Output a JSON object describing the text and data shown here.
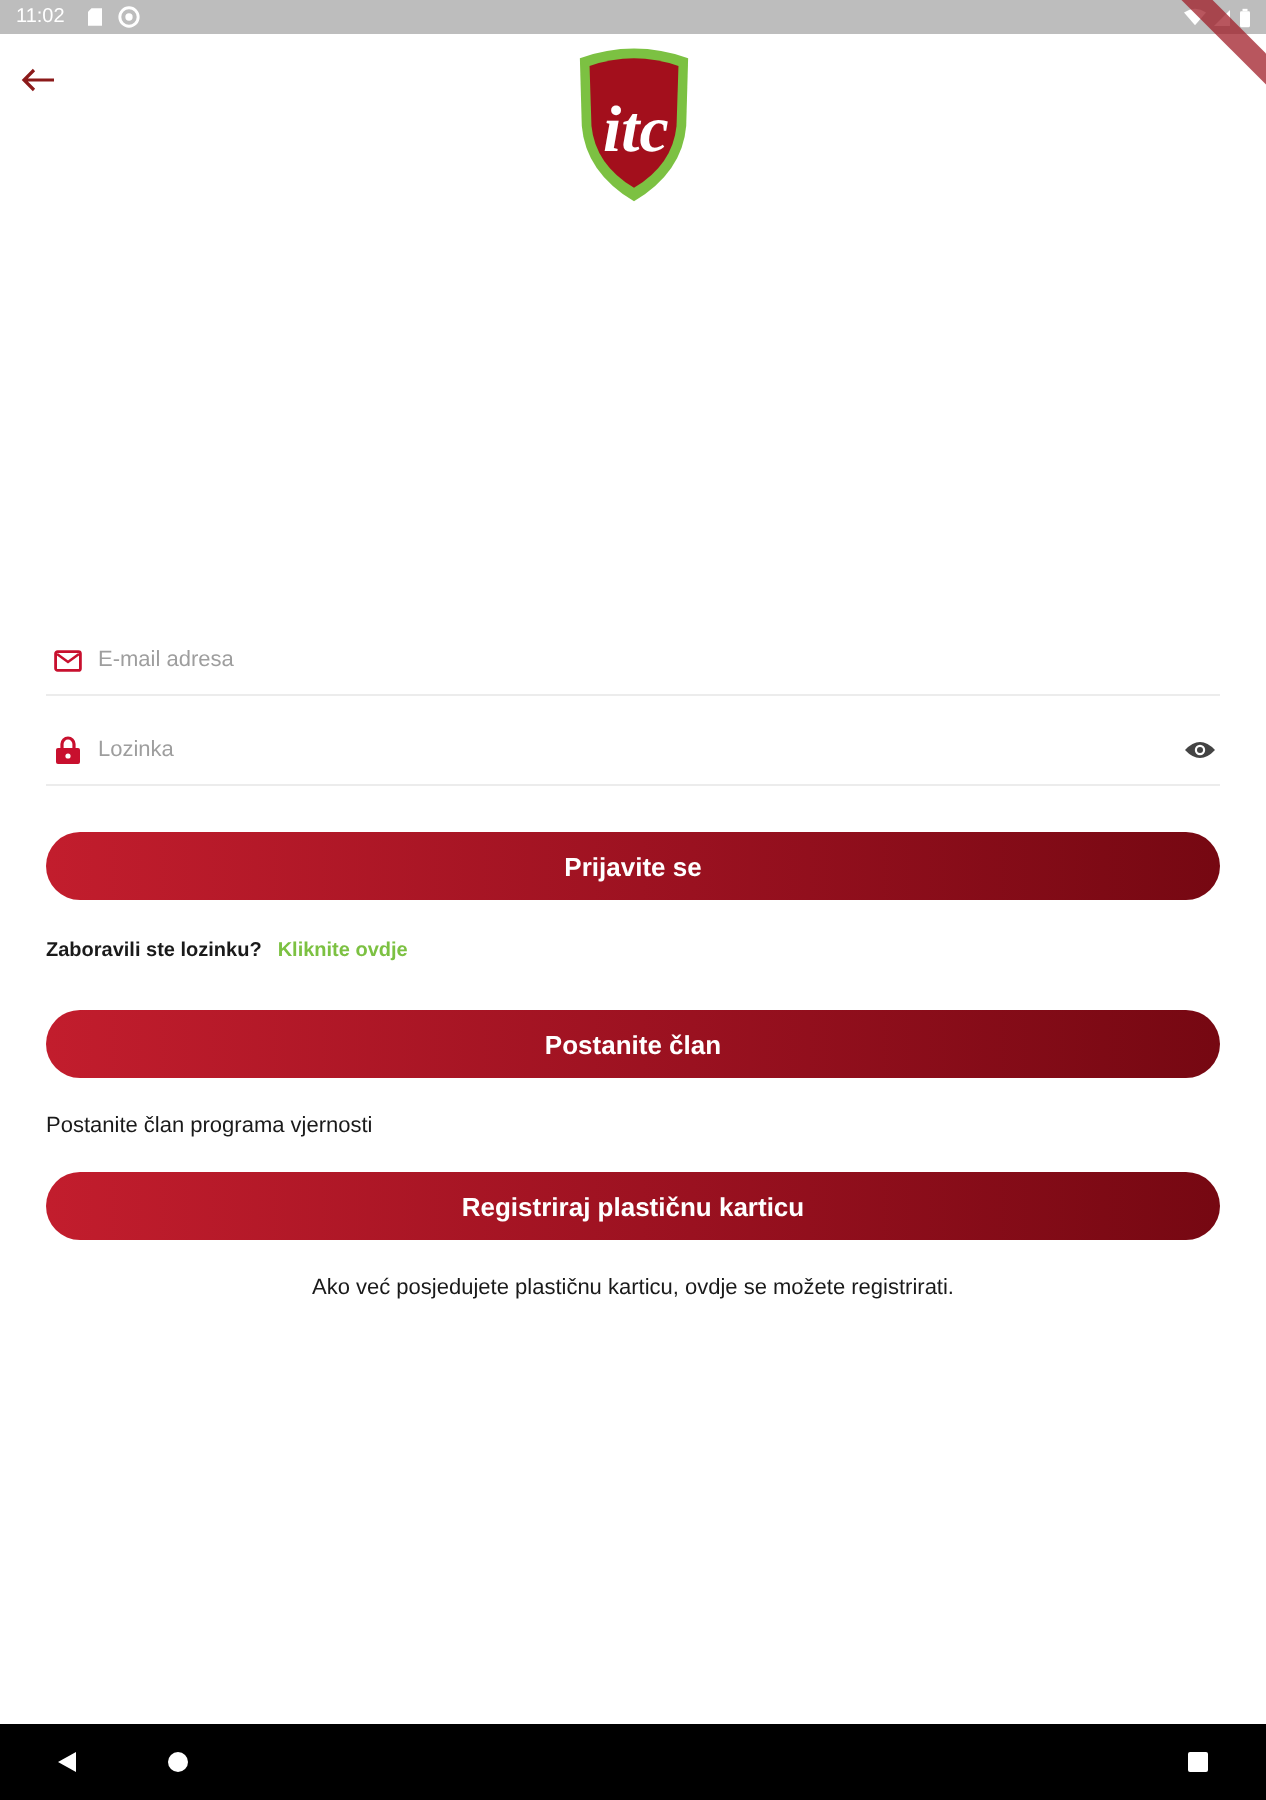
{
  "status_bar": {
    "time": "11:02"
  },
  "header": {
    "logo_text": "itc"
  },
  "login_form": {
    "fields": [
      {
        "kind": "email",
        "placeholder": "E-mail adresa"
      },
      {
        "kind": "password",
        "placeholder": "Lozinka"
      }
    ],
    "login_button": "Prijavite se",
    "forgot_password": {
      "text": "Zaboravili ste lozinku?",
      "link": "Kliknite ovdje"
    }
  },
  "membership": {
    "button": "Postanite član",
    "caption": "Postanite član programa vjernosti"
  },
  "plastic_card": {
    "button": "Registriraj plastičnu karticu",
    "caption": "Ako već posjedujete plastičnu karticu, ovdje se možete registrirati."
  }
}
